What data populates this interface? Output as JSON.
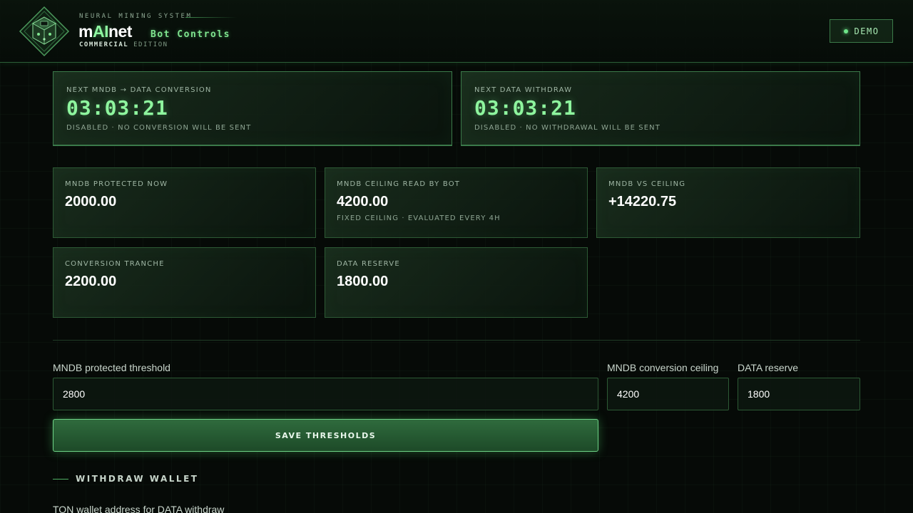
{
  "header": {
    "system": "NEURAL MINING SYSTEM",
    "brand_prefix": "m",
    "brand_ai": "AI",
    "brand_suffix": "net",
    "subtitle": "Bot Controls",
    "edition_bold": "COMMERCIAL",
    "edition": "EDITION",
    "demo_label": "DEMO",
    "logo_icon": "neural-cube-logo"
  },
  "timers": [
    {
      "label": "NEXT MNDB → DATA CONVERSION",
      "value": "03:03:21",
      "note": "DISABLED · NO CONVERSION WILL BE SENT"
    },
    {
      "label": "NEXT DATA WITHDRAW",
      "value": "03:03:21",
      "note": "DISABLED · NO WITHDRAWAL WILL BE SENT"
    }
  ],
  "stats": [
    {
      "label": "MNDB PROTECTED NOW",
      "value": "2000.00",
      "note": ""
    },
    {
      "label": "MNDB CEILING READ BY BOT",
      "value": "4200.00",
      "note": "FIXED CEILING · EVALUATED EVERY 4H"
    },
    {
      "label": "MNDB VS CEILING",
      "value": "+14220.75",
      "note": ""
    },
    {
      "label": "CONVERSION TRANCHE",
      "value": "2200.00",
      "note": ""
    },
    {
      "label": "DATA RESERVE",
      "value": "1800.00",
      "note": ""
    }
  ],
  "thresholds": {
    "protected_label": "MNDB protected threshold",
    "protected_value": "2800",
    "ceiling_label": "MNDB conversion ceiling",
    "ceiling_value": "4200",
    "reserve_label": "DATA reserve",
    "reserve_value": "1800",
    "save_label": "SAVE THRESHOLDS"
  },
  "withdraw": {
    "section_title": "WITHDRAW WALLET",
    "address_label": "TON wallet address for DATA withdraw"
  },
  "colors": {
    "accent": "#8ef59e",
    "border": "#2d5a35",
    "background": "#060a07"
  }
}
